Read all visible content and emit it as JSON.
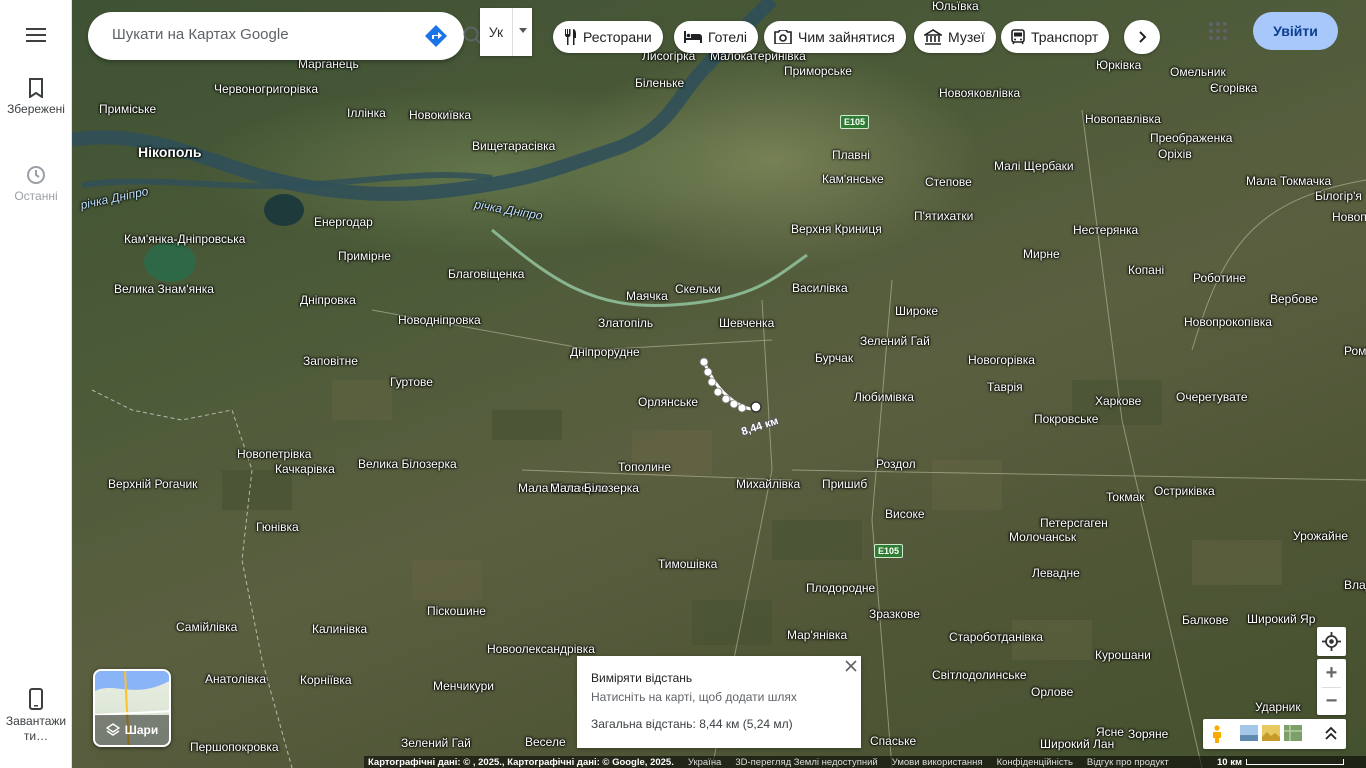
{
  "app": "Google Maps",
  "sidebar": {
    "items": [
      {
        "label": "Збережені",
        "icon": "bookmark-icon"
      },
      {
        "label": "Останні",
        "icon": "history-icon"
      },
      {
        "label": "Завантажити…",
        "icon": "phone-icon"
      }
    ]
  },
  "search": {
    "placeholder": "Шукати на Картах Google"
  },
  "ime": {
    "label": "Ук"
  },
  "chips": [
    {
      "label": "Ресторани",
      "icon": "restaurant-icon"
    },
    {
      "label": "Готелі",
      "icon": "hotel-icon"
    },
    {
      "label": "Чим зайнятися",
      "icon": "camera-icon"
    },
    {
      "label": "Музеї",
      "icon": "museum-icon"
    },
    {
      "label": "Транспорт",
      "icon": "transit-icon"
    }
  ],
  "signin": "Увійти",
  "layers": {
    "label": "Шари"
  },
  "measure": {
    "title": "Виміряти відстань",
    "hint": "Натисніть на карті, щоб додати шлях",
    "total": "Загальна відстань: 8,44 км (5,24 мл)",
    "path_label": "8,44 км"
  },
  "attribution": {
    "data": "Картографічні дані: © , 2025., Картографічні дані: © Google, 2025.",
    "country": "Україна",
    "threed": "3D-перегляд Землі недоступний",
    "terms": "Умови використання",
    "privacy": "Конфіденційність",
    "feedback": "Відгук про продукт",
    "scale": "10 км"
  },
  "places": [
    "Нікополь",
    "Марганець",
    "Червоногригорівка",
    "Іллінка",
    "Новокиївка",
    "Вищетарасівка",
    "Приміське",
    "Енергодар",
    "Кам'янка-Дніпровська",
    "Примірне",
    "Велика Знам'янка",
    "Благовіщенка",
    "Дніпровка",
    "Новодніпровка",
    "Маячка",
    "Скельки",
    "Златопіль",
    "Шевченка",
    "Дніпрорудне",
    "Заповітне",
    "Гуртове",
    "Орлянське",
    "Бурчак",
    "Зелений Гай",
    "Любимівка",
    "Василівка",
    "Широке",
    "Новогорівка",
    "Таврія",
    "Покровське",
    "Харкове",
    "Очеретувате",
    "Новопетрівка",
    "Качкарівка",
    "Велика Білозерка",
    "Верхній Рогачик",
    "Тополине",
    "Мала Білозерка",
    "Михайлівка",
    "Пришиб",
    "Роздол",
    "Високе",
    "Гюнівка",
    "Тимошівка",
    "Плодородне",
    "Зразкове",
    "Мар'янівка",
    "Самійлівка",
    "Калинівка",
    "Піскошине",
    "Новоолександрівка",
    "Менчикури",
    "Зелений Гай",
    "Веселе",
    "Анатолівка",
    "Корнiївка",
    "Першопокровка",
    "Спаське",
    "Світлодолинське",
    "Староботданівка",
    "Орлове",
    "Курошани",
    "Балкове",
    "Широкий Яр",
    "Ударник",
    "Ясне",
    "Зоряне",
    "Широкий Лан",
    "Молочанськ",
    "Леваднe",
    "Петерсгаген",
    "Токмак",
    "Остриківка",
    "Урожайне",
    "Владівка",
    "Біленьке",
    "Лисогірка",
    "Малокатеринівка",
    "Приморське",
    "Юльївка",
    "Юрківка",
    "Омельник",
    "Єгорівка",
    "Новояковлівка",
    "Плавні",
    "Кам'янське",
    "Степове",
    "П'ятихатки",
    "Малі Щербаки",
    "Новопавлівка",
    "Преображенка",
    "Оріхів",
    "Мала Токмачка",
    "Білогір'я",
    "Новопокровка",
    "Нестерянка",
    "Мирне",
    "Копані",
    "Роботине",
    "Вербове",
    "Новопрокопівка",
    "Верхня Криниця",
    "Романівка",
    "Мала Білозерка"
  ],
  "rivers": [
    "річка Дніпро",
    "річка Дніпро"
  ],
  "roads": [
    "E105",
    "E105"
  ]
}
